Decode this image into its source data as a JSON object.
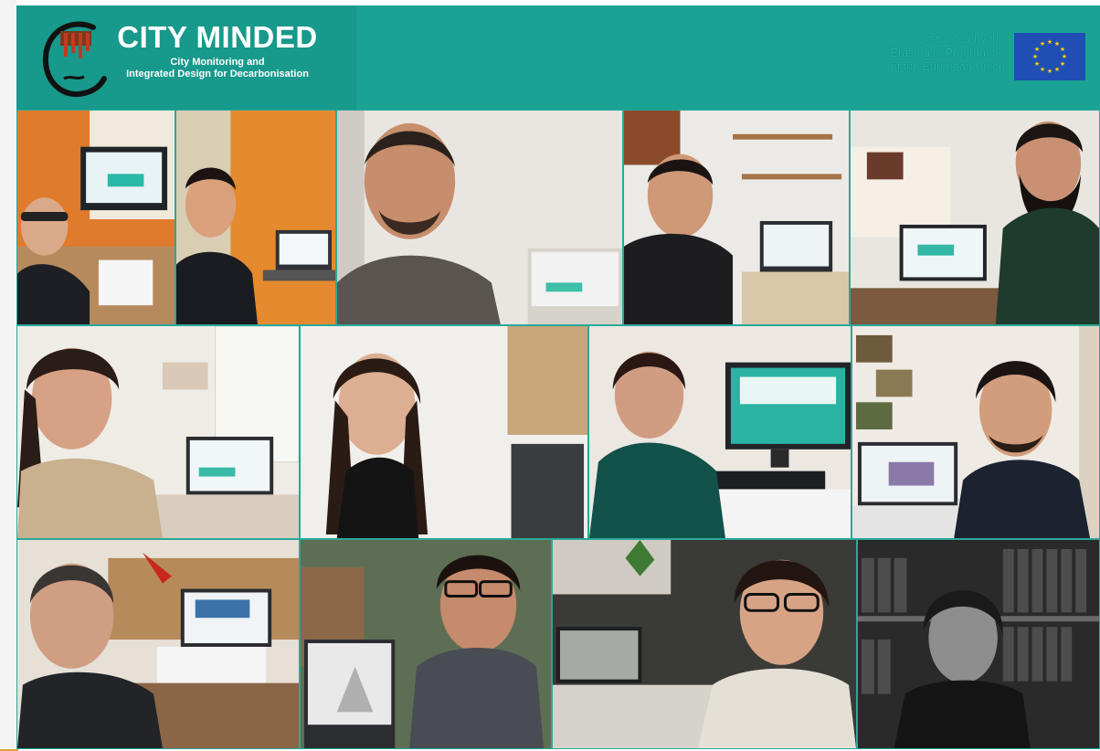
{
  "header": {
    "project_title": "CITY MINDED",
    "subtitle_line1": "City Monitoring and",
    "subtitle_line2": "Integrated Design for Decarbonisation",
    "eu_line1": "Co-funded by the",
    "eu_line2": "Erasmus+ Programme",
    "eu_line3": "of the European Union",
    "accent_color": "#1aa394",
    "flag_color": "#1f4fb4",
    "star_color": "#ffd400"
  },
  "tiles": [
    {
      "name": "participant-1",
      "scene": "orange-office"
    },
    {
      "name": "participant-2",
      "scene": "orange-wall-laptop"
    },
    {
      "name": "participant-3",
      "scene": "grey-wall-closeup"
    },
    {
      "name": "participant-4",
      "scene": "shelf-desk"
    },
    {
      "name": "participant-5",
      "scene": "bearded-desk"
    },
    {
      "name": "participant-6",
      "scene": "white-cabinet"
    },
    {
      "name": "participant-7",
      "scene": "white-wall"
    },
    {
      "name": "participant-8",
      "scene": "monitor-desk"
    },
    {
      "name": "participant-9",
      "scene": "photos-wall"
    },
    {
      "name": "participant-10",
      "scene": "lamp-desk"
    },
    {
      "name": "participant-11",
      "scene": "books-laptop"
    },
    {
      "name": "participant-12",
      "scene": "plant-desk"
    },
    {
      "name": "participant-13",
      "scene": "library-bw"
    }
  ]
}
